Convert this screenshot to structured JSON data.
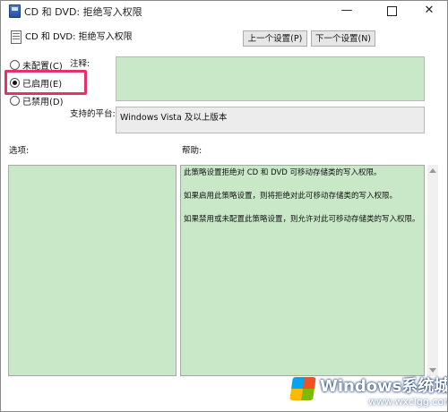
{
  "window": {
    "title": "CD 和 DVD: 拒绝写入权限",
    "minimize_glyph": "—",
    "close_glyph": "✕"
  },
  "header": {
    "policy_name": "CD 和 DVD: 拒绝写入权限",
    "prev_button": "上一个设置(P)",
    "next_button": "下一个设置(N)"
  },
  "state_options": [
    {
      "label": "未配置(C)",
      "selected": false
    },
    {
      "label": "已启用(E)",
      "selected": true
    },
    {
      "label": "已禁用(D)",
      "selected": false
    }
  ],
  "highlight_color": "#e5326b",
  "field_color": "#c8e8c8",
  "comment": {
    "label": "注释:",
    "value": ""
  },
  "supported_on": {
    "label": "支持的平台:",
    "value": "Windows Vista 及以上版本"
  },
  "options_section": {
    "label": "选项:"
  },
  "help_section": {
    "label": "帮助:",
    "paragraphs": [
      "此策略设置拒绝对 CD 和 DVD 可移动存储类的写入权限。",
      "如果启用此策略设置，则将拒绝对此可移动存储类的写入权限。",
      "如果禁用或未配置此策略设置，则允许对此可移动存储类的写入权限。"
    ]
  },
  "watermark": {
    "title": "Windows系统城",
    "url": "www.wxclgg.com"
  }
}
